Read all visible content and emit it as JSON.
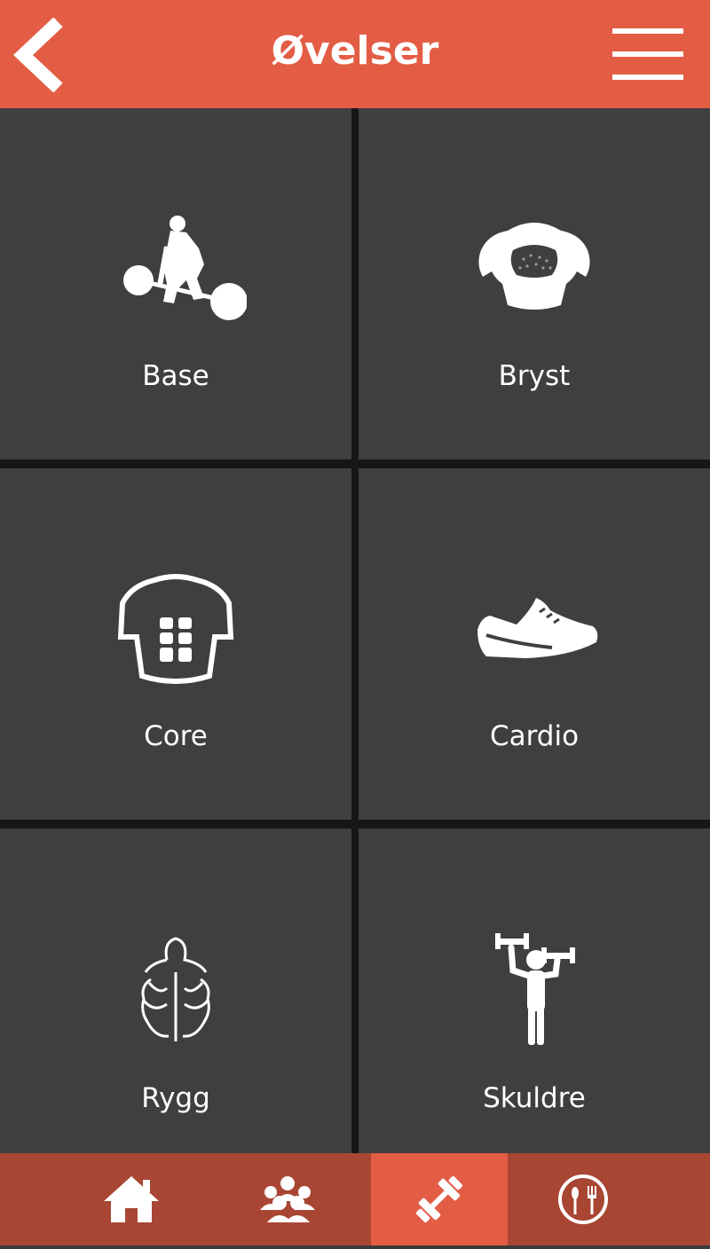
{
  "header": {
    "title": "Øvelser",
    "back_icon": "chevron-left-icon",
    "menu_icon": "hamburger-menu-icon",
    "color": "#e35d45"
  },
  "categories": [
    {
      "label": "Base",
      "icon": "deadlift-icon"
    },
    {
      "label": "Bryst",
      "icon": "chest-icon"
    },
    {
      "label": "Core",
      "icon": "abs-torso-icon"
    },
    {
      "label": "Cardio",
      "icon": "running-shoe-icon"
    },
    {
      "label": "Rygg",
      "icon": "back-muscles-icon"
    },
    {
      "label": "Skuldre",
      "icon": "shoulder-press-icon"
    }
  ],
  "tabbar": {
    "tabs": [
      {
        "icon": "home-icon",
        "active": false
      },
      {
        "icon": "group-icon",
        "active": false
      },
      {
        "icon": "dumbbell-icon",
        "active": true
      },
      {
        "icon": "plate-cutlery-icon",
        "active": false
      }
    ],
    "bar_color": "#a84633",
    "active_color": "#e35d45"
  }
}
